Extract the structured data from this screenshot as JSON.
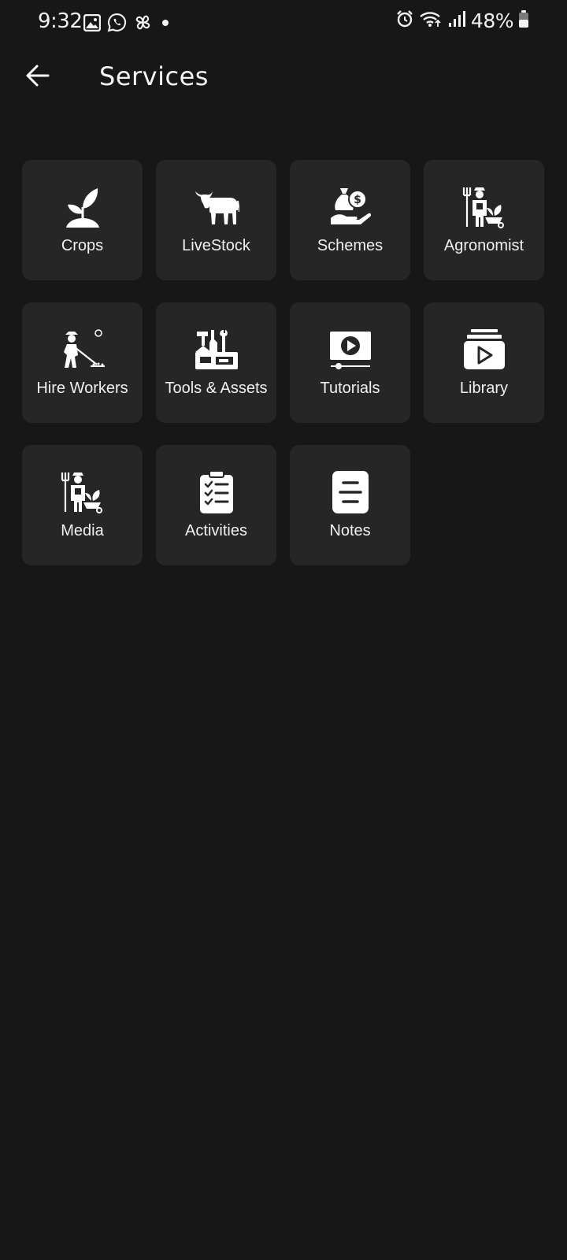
{
  "status_bar": {
    "time": "9:32",
    "left_icons": [
      "gallery-icon",
      "whatsapp-icon",
      "pinwheel-icon",
      "dot-icon"
    ],
    "right_icons": [
      "alarm-icon",
      "wifi-icon",
      "signal-icon",
      "battery-icon"
    ],
    "battery": "48%"
  },
  "app_bar": {
    "back_icon": "arrow-left-icon",
    "title": "Services"
  },
  "services": [
    {
      "label": "Crops",
      "icon": "sprout-icon"
    },
    {
      "label": "LiveStock",
      "icon": "cow-icon"
    },
    {
      "label": "Schemes",
      "icon": "money-bag-hand-icon"
    },
    {
      "label": "Agronomist",
      "icon": "farmer-wheelbarrow-icon"
    },
    {
      "label": "Hire Workers",
      "icon": "worker-raking-icon"
    },
    {
      "label": "Tools & Assets",
      "icon": "toolbox-icon"
    },
    {
      "label": "Tutorials",
      "icon": "video-player-icon"
    },
    {
      "label": "Library",
      "icon": "video-library-icon"
    },
    {
      "label": "Media",
      "icon": "farmer-wheelbarrow-icon"
    },
    {
      "label": "Activities",
      "icon": "clipboard-checklist-icon"
    },
    {
      "label": "Notes",
      "icon": "note-icon"
    }
  ],
  "colors": {
    "background": "#171717",
    "tile": "#262626",
    "text": "#ffffff"
  }
}
